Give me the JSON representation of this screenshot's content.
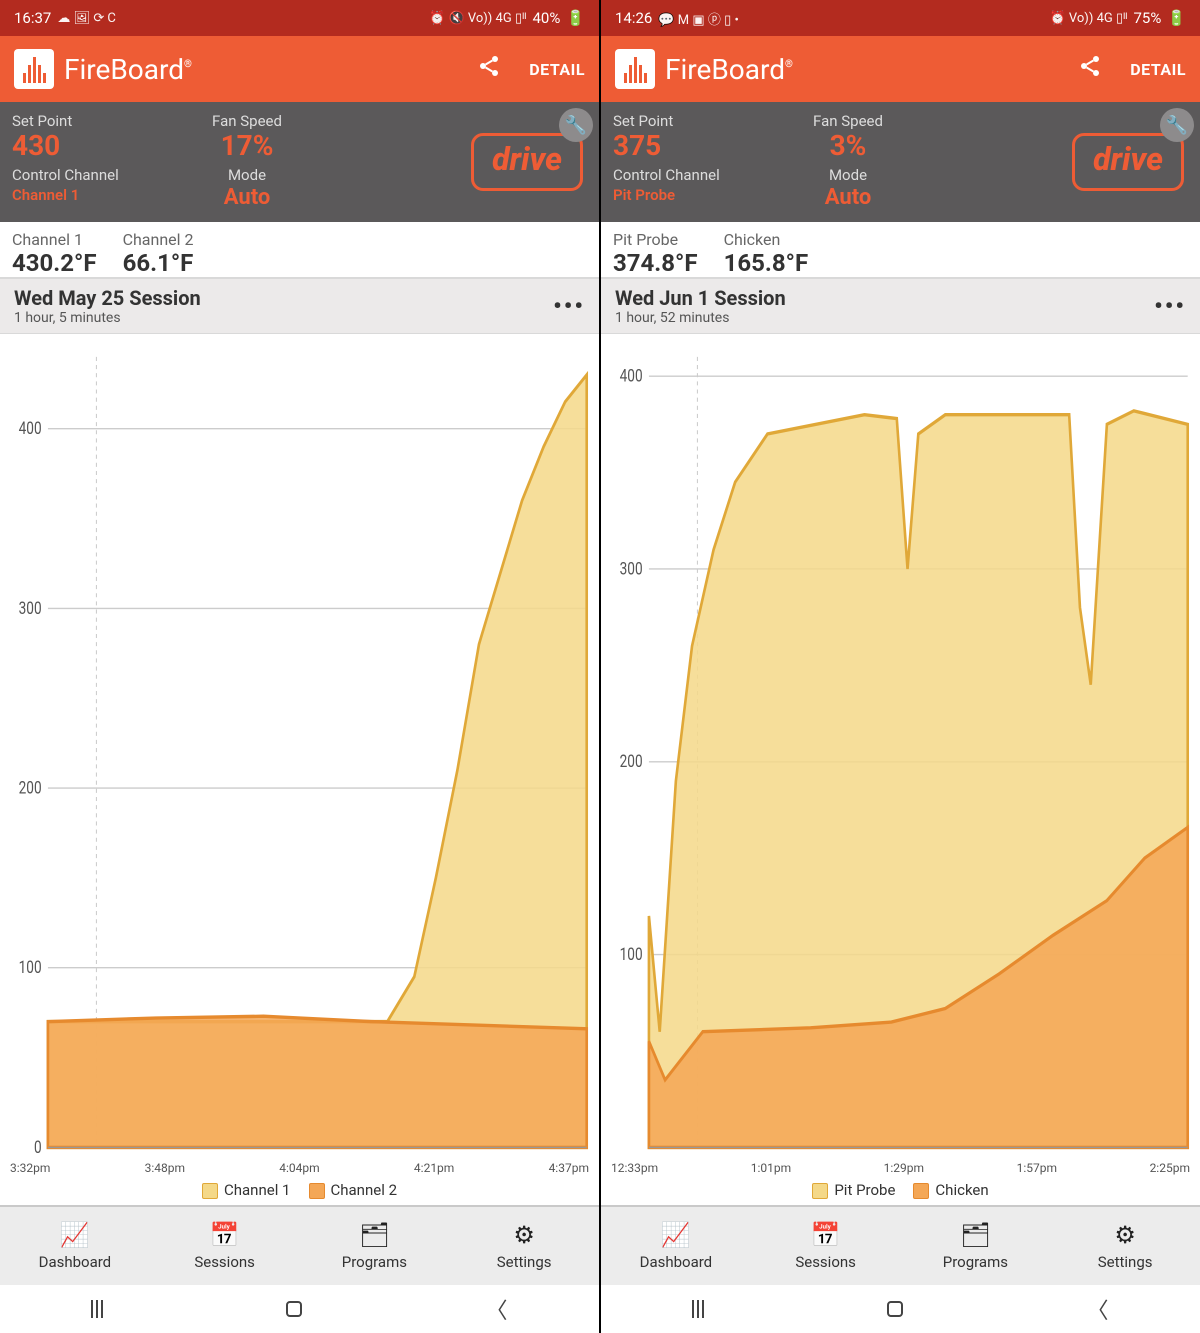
{
  "screens": [
    {
      "status": {
        "time": "16:37",
        "left_icons": "☁ 🖼 ⟳ C",
        "right_icons": "⏰ 🔇 Vo)) 4G ▯ᴵᴵ",
        "battery": "40%"
      },
      "header": {
        "app_name": "FireBoard",
        "detail": "DETAIL"
      },
      "drive": {
        "set_point_label": "Set Point",
        "set_point": "430",
        "control_channel_label": "Control Channel",
        "control_channel": "Channel 1",
        "fan_speed_label": "Fan Speed",
        "fan_speed": "17%",
        "mode_label": "Mode",
        "mode": "Auto",
        "badge": "drive"
      },
      "channels": [
        {
          "label": "Channel 1",
          "value": "430.2°F"
        },
        {
          "label": "Channel 2",
          "value": "66.1°F"
        }
      ],
      "session": {
        "title": "Wed May 25 Session",
        "duration": "1 hour, 5 minutes"
      },
      "nav": {
        "dashboard": "Dashboard",
        "sessions": "Sessions",
        "programs": "Programs",
        "settings": "Settings"
      }
    },
    {
      "status": {
        "time": "14:26",
        "left_icons": "💬 M ▣ ⓟ ▯ •",
        "right_icons": "⏰ Vo)) 4G ▯ᴵᴵ",
        "battery": "75%"
      },
      "header": {
        "app_name": "FireBoard",
        "detail": "DETAIL"
      },
      "drive": {
        "set_point_label": "Set Point",
        "set_point": "375",
        "control_channel_label": "Control Channel",
        "control_channel": "Pit Probe",
        "fan_speed_label": "Fan Speed",
        "fan_speed": "3%",
        "mode_label": "Mode",
        "mode": "Auto",
        "badge": "drive"
      },
      "channels": [
        {
          "label": "Pit Probe",
          "value": "374.8°F"
        },
        {
          "label": "Chicken",
          "value": "165.8°F"
        }
      ],
      "session": {
        "title": "Wed Jun 1 Session",
        "duration": "1 hour, 52 minutes"
      },
      "nav": {
        "dashboard": "Dashboard",
        "sessions": "Sessions",
        "programs": "Programs",
        "settings": "Settings"
      }
    }
  ],
  "chart_data": [
    {
      "type": "area",
      "x_labels": [
        "3:32pm",
        "3:48pm",
        "4:04pm",
        "4:21pm",
        "4:37pm"
      ],
      "y_ticks": [
        0,
        100,
        200,
        300,
        400
      ],
      "ylim": [
        0,
        440
      ],
      "colors": {
        "s1_fill": "#f4d888",
        "s1_stroke": "#e0a838",
        "s2_fill": "#f4a756",
        "s2_stroke": "#e68a2e"
      },
      "series": [
        {
          "name": "Channel 1",
          "x": [
            0,
            0.63,
            0.68,
            0.72,
            0.76,
            0.8,
            0.84,
            0.88,
            0.92,
            0.96,
            1.0
          ],
          "y": [
            70,
            70,
            95,
            150,
            210,
            280,
            320,
            360,
            390,
            415,
            430
          ]
        },
        {
          "name": "Channel 2",
          "x": [
            0,
            0.2,
            0.4,
            0.6,
            0.8,
            1.0
          ],
          "y": [
            70,
            72,
            73,
            70,
            68,
            66
          ]
        }
      ]
    },
    {
      "type": "area",
      "x_labels": [
        "12:33pm",
        "1:01pm",
        "1:29pm",
        "1:57pm",
        "2:25pm"
      ],
      "y_ticks": [
        100,
        200,
        300,
        400
      ],
      "ylim": [
        0,
        410
      ],
      "colors": {
        "s1_fill": "#f4d888",
        "s1_stroke": "#e0a838",
        "s2_fill": "#f4a756",
        "s2_stroke": "#e68a2e"
      },
      "series": [
        {
          "name": "Pit Probe",
          "x": [
            0,
            0.02,
            0.05,
            0.08,
            0.12,
            0.16,
            0.22,
            0.4,
            0.46,
            0.48,
            0.5,
            0.55,
            0.72,
            0.78,
            0.8,
            0.82,
            0.85,
            0.9,
            1.0
          ],
          "y": [
            120,
            60,
            190,
            260,
            310,
            345,
            370,
            380,
            378,
            300,
            370,
            380,
            380,
            380,
            280,
            240,
            375,
            382,
            375
          ]
        },
        {
          "name": "Chicken",
          "x": [
            0,
            0.03,
            0.1,
            0.3,
            0.45,
            0.55,
            0.65,
            0.75,
            0.85,
            0.92,
            1.0
          ],
          "y": [
            55,
            35,
            60,
            62,
            65,
            72,
            90,
            110,
            128,
            150,
            166
          ]
        }
      ]
    }
  ]
}
